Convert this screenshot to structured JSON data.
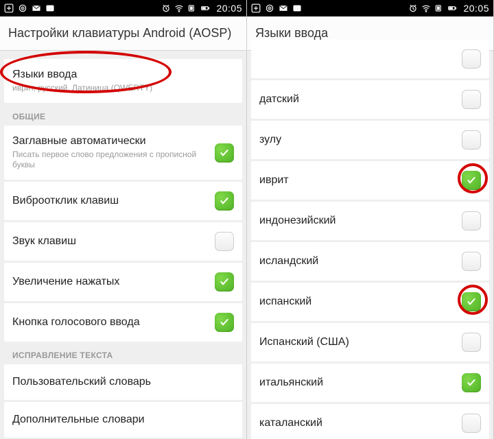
{
  "status": {
    "time": "20:05"
  },
  "left": {
    "header": "Настройки клавиатуры Android (AOSP)",
    "inputLangs": {
      "title": "Языки ввода",
      "sub": "иврит, русский, Латиница (QWERTY)"
    },
    "sectionGeneral": "ОБЩИЕ",
    "items": [
      {
        "title": "Заглавные автоматически",
        "sub": "Писать первое слово предложения с прописной буквы",
        "on": true
      },
      {
        "title": "Виброотклик клавиш",
        "on": true
      },
      {
        "title": "Звук клавиш",
        "on": false
      },
      {
        "title": "Увеличение нажатых",
        "on": true
      },
      {
        "title": "Кнопка голосового ввода",
        "on": true
      }
    ],
    "sectionCorrection": "ИСПРАВЛЕНИЕ ТЕКСТА",
    "dicts": [
      {
        "title": "Пользовательский словарь"
      },
      {
        "title": "Дополнительные словари"
      }
    ]
  },
  "right": {
    "header": "Языки ввода",
    "langs": [
      {
        "title": "датский",
        "on": false
      },
      {
        "title": "зулу",
        "on": false
      },
      {
        "title": "иврит",
        "on": true,
        "highlight": true
      },
      {
        "title": "индонезийский",
        "on": false
      },
      {
        "title": "исландский",
        "on": false
      },
      {
        "title": "испанский",
        "on": true,
        "highlight": true
      },
      {
        "title": "Испанский (США)",
        "on": false
      },
      {
        "title": "итальянский",
        "on": true
      },
      {
        "title": "каталанский",
        "on": false
      }
    ]
  }
}
